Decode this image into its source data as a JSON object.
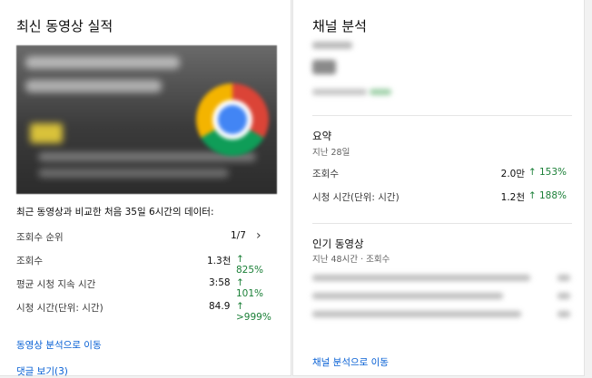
{
  "left_card": {
    "title": "최신 동영상 실적",
    "comparison_text": "최근 동영상과 비교한 처음 35일 6시간의 데이터:",
    "rank_row": {
      "label": "조회수 순위",
      "value": "1/7",
      "chevron": "›"
    },
    "metrics": [
      {
        "label": "조회수",
        "value": "1.3천",
        "change": "825%"
      },
      {
        "label": "평균 시청 지속 시간",
        "value": "3:58",
        "change": "101%"
      },
      {
        "label": "시청 시간(단위: 시간)",
        "value": "84.9",
        "change": ">999%"
      }
    ],
    "video_analytics_link": "동영상 분석으로 이동",
    "comments_link": "댓글 보기(3)"
  },
  "right_card": {
    "title": "채널 분석",
    "summary": {
      "title": "요약",
      "period": "지난 28일",
      "rows": [
        {
          "label": "조회수",
          "value": "2.0만",
          "change": "153%"
        },
        {
          "label": "시청 시간(단위: 시간)",
          "value": "1.2천",
          "change": "188%"
        }
      ]
    },
    "popular": {
      "title": "인기 동영상",
      "subtitle": "지난 48시간 · 조회수"
    },
    "channel_analytics_link": "채널 분석으로 이동"
  },
  "icons": {
    "up_arrow": "up-arrow-icon",
    "chevron": "chevron-right-icon"
  },
  "colors": {
    "positive": "#1a7f37",
    "link": "#065fd4"
  }
}
